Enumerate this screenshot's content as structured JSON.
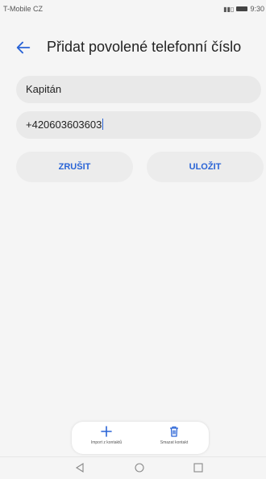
{
  "status_bar": {
    "carrier": "T-Mobile CZ",
    "indicators": "⚡ ⁴⁄ₗ",
    "time": "9:30"
  },
  "header": {
    "title": "Přidat povolené telefonní číslo",
    "back_icon": "arrow-left-icon"
  },
  "form": {
    "name_value": "Kapitán",
    "number_value": "+420603603603"
  },
  "buttons": {
    "cancel_label": "ZRUŠIT",
    "save_label": "ULOŽIT"
  },
  "bottom_actions": [
    {
      "label": "Import z kontaktů",
      "icon": "plus-icon"
    },
    {
      "label": "Smazat kontakt",
      "icon": "trash-icon"
    }
  ],
  "navigation": {
    "back": "triangle-back-icon",
    "home": "circle-home-icon",
    "recent": "square-recent-icon"
  },
  "colors": {
    "accent": "#2a64d6",
    "background": "#f5f5f5",
    "field": "#e9e9e9"
  }
}
